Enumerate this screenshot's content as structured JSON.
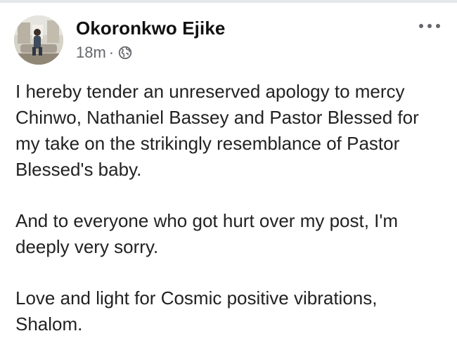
{
  "author": {
    "name": "Okoronkwo Ejike",
    "timestamp": "18m",
    "separator": "·",
    "privacy_icon": "globe-icon",
    "avatar_icon": "profile-photo"
  },
  "menu": {
    "icon": "more-options-icon"
  },
  "post": {
    "paragraphs": [
      "I hereby tender an unreserved apology to mercy Chinwo, Nathaniel Bassey and Pastor Blessed for my take on the strikingly resemblance of Pastor Blessed's baby.",
      "And to everyone who got hurt over my post, I'm deeply very sorry.",
      "Love and light for Cosmic positive vibrations, Shalom."
    ]
  },
  "colors": {
    "text": "#222222",
    "meta": "#65676b",
    "divider": "#e4e6ea"
  }
}
